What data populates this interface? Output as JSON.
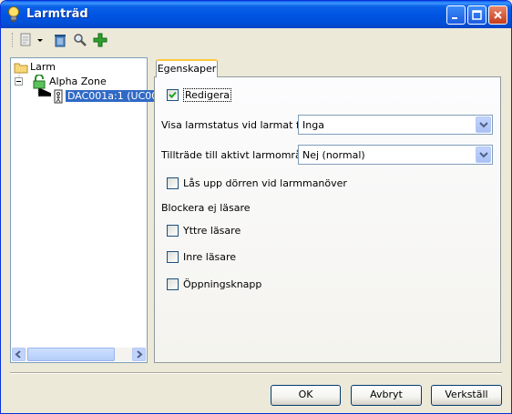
{
  "window": {
    "title": "Larmträd",
    "accent_color": "#0054e3",
    "controls": [
      "minimize-icon",
      "maximize-icon",
      "close-icon"
    ]
  },
  "toolbar": {
    "items": [
      "new-item-icon",
      "dropdown-arrow-icon",
      "delete-icon",
      "search-icon",
      "add-icon"
    ]
  },
  "tree": {
    "root": {
      "label": "Larm",
      "icon": "folder-icon"
    },
    "zone": {
      "label": "Alpha Zone",
      "icon": "lock-icon",
      "expanded": true
    },
    "door": {
      "label": "DAC001a:1 (UC00",
      "icon": "door-icon",
      "selected": true
    }
  },
  "tabs": [
    {
      "label": "Egenskaper",
      "active": true
    }
  ],
  "form": {
    "edit": {
      "label": "Redigera",
      "checked": true
    },
    "alarm_status": {
      "label": "Visa larmstatus vid larmat för",
      "value": "Inga"
    },
    "access": {
      "label": "Tillträde till aktivt larmområde",
      "value": "Nej (normal)"
    },
    "unlock": {
      "label": "Lås upp dörren vid larmmanöver",
      "checked": false
    },
    "block_heading": "Blockera ej läsare",
    "outer_reader": {
      "label": "Yttre läsare",
      "checked": false
    },
    "inner_reader": {
      "label": "Inre läsare",
      "checked": false
    },
    "open_button": {
      "label": "Öppningsknapp",
      "checked": false
    }
  },
  "buttons": {
    "ok": "OK",
    "cancel": "Avbryt",
    "apply": "Verkställ"
  }
}
